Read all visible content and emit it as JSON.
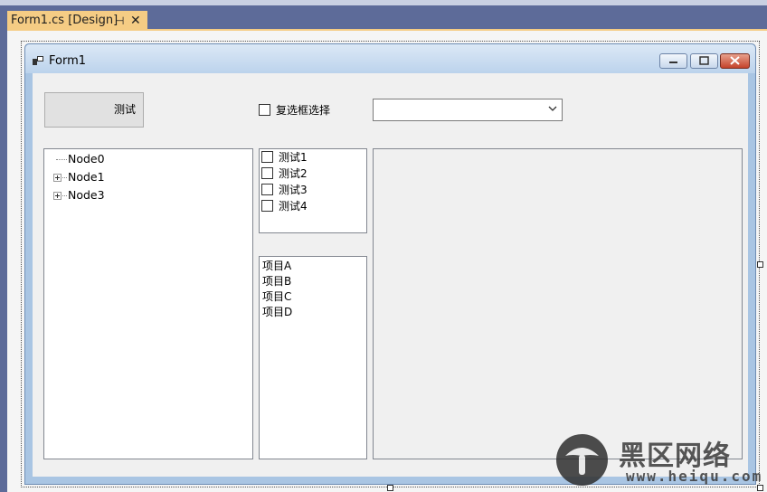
{
  "editor": {
    "tab_title": "Form1.cs [Design]",
    "pin_glyph": "⊣",
    "close_glyph": "✕"
  },
  "form": {
    "title": "Form1",
    "button_label": "测试",
    "checkbox_label": "复选框选择",
    "combo_value": "",
    "tree_nodes": [
      {
        "label": "Node0",
        "expandable": false
      },
      {
        "label": "Node1",
        "expandable": true
      },
      {
        "label": "Node3",
        "expandable": true
      }
    ],
    "checked_list_items": [
      "测试1",
      "测试2",
      "测试3",
      "测试4"
    ],
    "list_items": [
      "项目A",
      "项目B",
      "项目C",
      "项目D"
    ]
  },
  "watermark": {
    "text": "黑区网络",
    "url": "www.heiqu.com"
  }
}
